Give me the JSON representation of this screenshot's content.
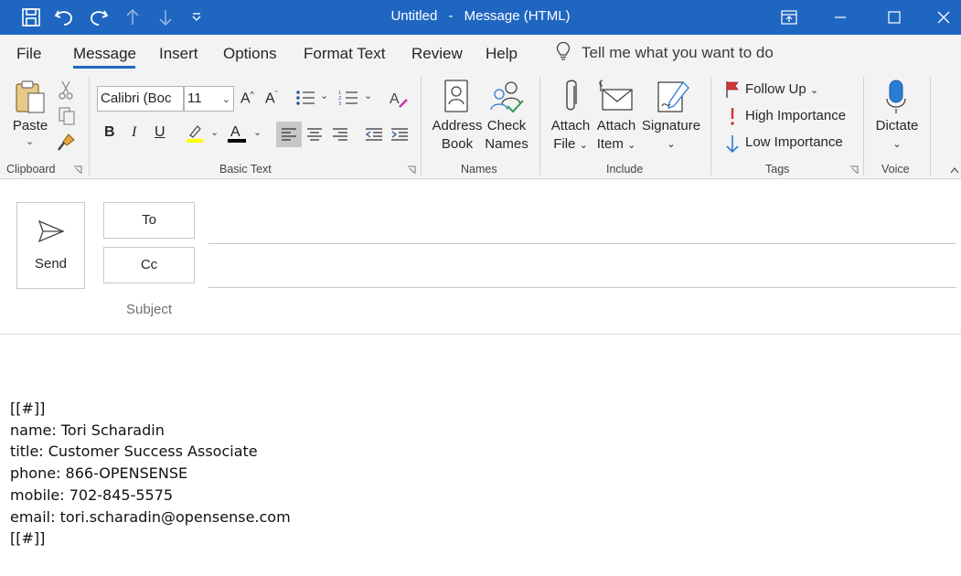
{
  "window": {
    "title": "Untitled",
    "separator": "-",
    "subtitle": "Message (HTML)"
  },
  "menu": {
    "tabs": [
      "File",
      "Message",
      "Insert",
      "Options",
      "Format Text",
      "Review",
      "Help"
    ],
    "active_tab": "Message",
    "tell_me": "Tell me what you want to do"
  },
  "ribbon": {
    "clipboard": {
      "label": "Clipboard",
      "paste": "Paste"
    },
    "basic_text": {
      "label": "Basic Text",
      "font_name": "Calibri (Boc",
      "font_size": "11",
      "bold": "B",
      "italic": "I",
      "underline": "U",
      "font_color_letter": "A",
      "grow_letter": "A",
      "shrink_letter": "A"
    },
    "names": {
      "label": "Names",
      "address_book": [
        "Address",
        "Book"
      ],
      "check_names": [
        "Check",
        "Names"
      ]
    },
    "include": {
      "label": "Include",
      "attach_file": [
        "Attach",
        "File"
      ],
      "attach_item": [
        "Attach",
        "Item"
      ],
      "signature": "Signature"
    },
    "tags": {
      "label": "Tags",
      "follow_up": "Follow Up",
      "high_importance": "High Importance",
      "low_importance": "Low Importance"
    },
    "voice": {
      "label": "Voice",
      "dictate": "Dictate"
    }
  },
  "compose": {
    "send": "Send",
    "to": "To",
    "cc": "Cc",
    "subject": "Subject"
  },
  "body": {
    "lines": [
      "[[#]]",
      "name: Tori Scharadin",
      "title: Customer Success Associate",
      "phone: 866-OPENSENSE",
      "mobile: 702-845-5575",
      "email: tori.scharadin@opensense.com",
      "[[#]]"
    ]
  },
  "colors": {
    "titlebar": "#1f66c1",
    "ribbon_bg": "#f3f3f3",
    "highlight_yellow": "#ffff00",
    "font_color": "#000000",
    "flag_red": "#d13438",
    "low_importance_blue": "#2b7cd3"
  },
  "icons": [
    "save-icon",
    "undo-icon",
    "redo-icon",
    "up-arrow-icon",
    "down-arrow-icon",
    "customize-qat-icon",
    "ribbon-display-icon",
    "minimize-icon",
    "maximize-icon",
    "close-icon",
    "lightbulb-icon",
    "paste-icon",
    "cut-icon",
    "copy-icon",
    "format-painter-icon",
    "bullets-icon",
    "numbering-icon",
    "clear-format-icon",
    "highlight-icon",
    "align-left-icon",
    "align-center-icon",
    "align-right-icon",
    "decrease-indent-icon",
    "increase-indent-icon",
    "address-book-icon",
    "check-names-icon",
    "paperclip-icon",
    "envelope-icon",
    "signature-icon",
    "flag-icon",
    "exclamation-icon",
    "down-arrow-importance-icon",
    "microphone-icon",
    "send-icon",
    "collapse-ribbon-icon"
  ]
}
